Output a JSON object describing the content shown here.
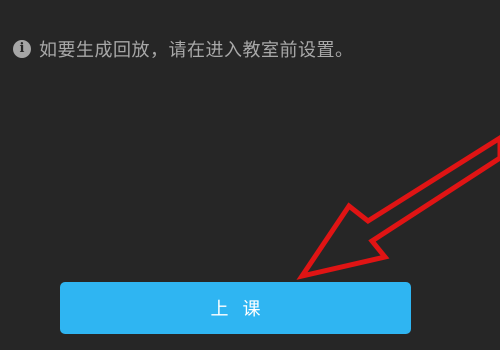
{
  "notice": {
    "icon": "info-icon",
    "icon_glyph": "i",
    "text": "如要生成回放，请在进入教室前设置。"
  },
  "action": {
    "start_class_label": "上课"
  },
  "annotation": {
    "icon": "arrow-icon",
    "color": "#e01414"
  },
  "colors": {
    "background": "#262626",
    "button": "#2fb5f2",
    "notice_text": "#a8a8a8"
  }
}
